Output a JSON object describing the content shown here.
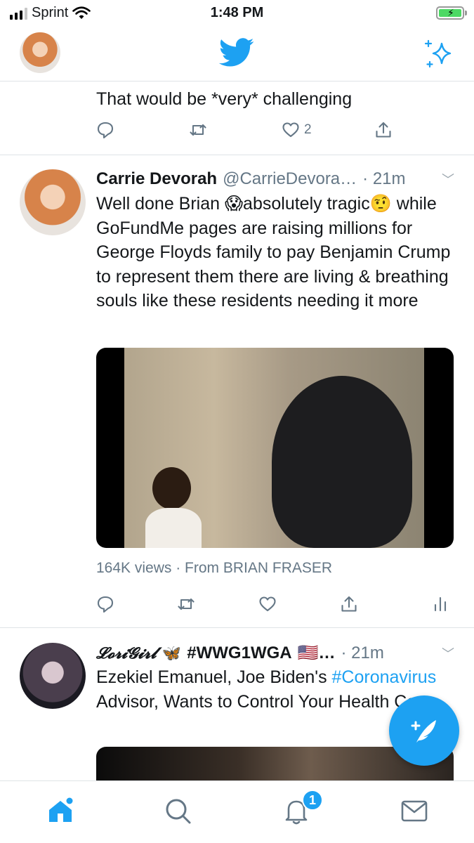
{
  "status_bar": {
    "carrier": "Sprint",
    "time": "1:48 PM"
  },
  "header": {
    "logo": "twitter-bird-icon",
    "sparkle": "sparkle-icon"
  },
  "tweets": [
    {
      "text": "That would be *very* challenging",
      "likes": "2"
    },
    {
      "name": "Carrie Devorah",
      "handle": "@CarrieDevora…",
      "time": "· 21m",
      "text_a": "Well done Brian ",
      "emoji_a": "😱",
      "text_b": "absolutely tragic",
      "emoji_b": "🤨",
      "text_c": " while GoFundMe pages are raising millions for George Floyds family to pay Benjamin Crump to represent them there are living & breathing souls like these residents needing it more",
      "video_views": "164K views · From BRIAN FRASER"
    },
    {
      "name": "𝓛𝓸𝓻𝓲𝓖𝓲𝓻𝓵",
      "name_emoji": "🦋",
      "name_tag": "#WWG1WGA",
      "flag": "🇺🇸…",
      "time": "· 21m",
      "text_a": "Ezekiel Emanuel, Joe Biden's ",
      "hashtag": "#Coronavirus",
      "text_b": " Advisor, Wants to Control Your Health Care"
    }
  ],
  "tabbar": {
    "notification_count": "1"
  },
  "colors": {
    "accent": "#1da1f2",
    "text": "#14171a",
    "muted": "#657786"
  }
}
